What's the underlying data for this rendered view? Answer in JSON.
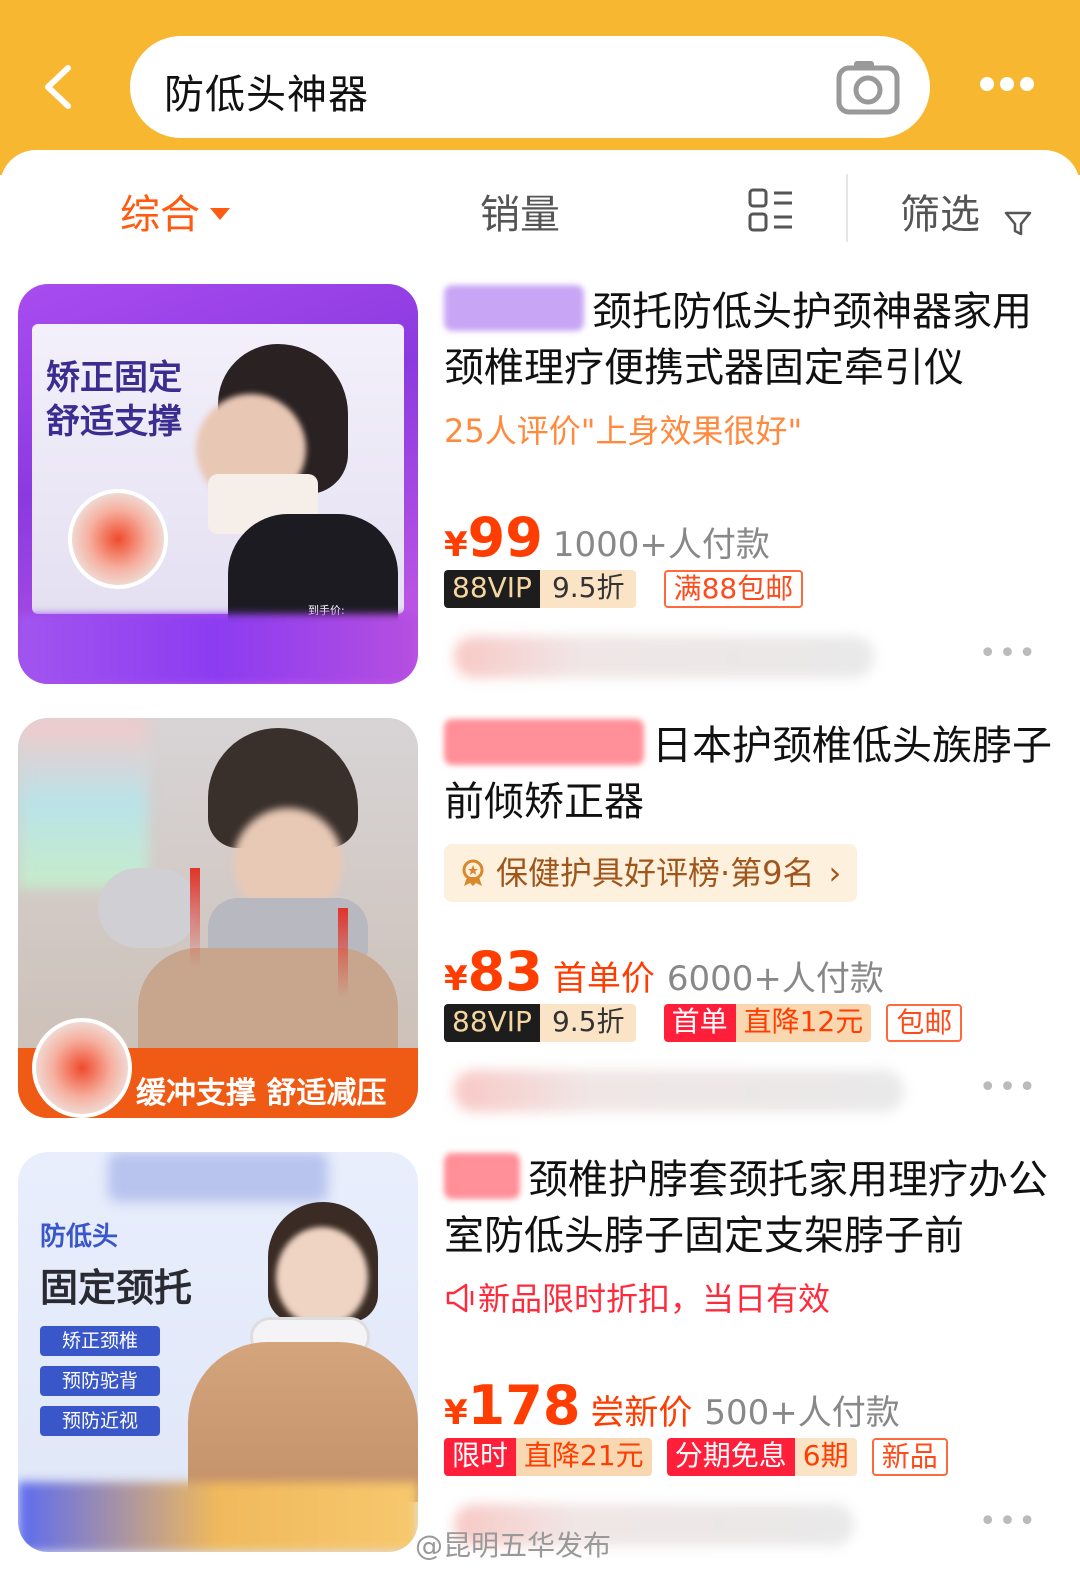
{
  "header": {
    "search_value": "防低头神器",
    "bg_color": "#f7b731"
  },
  "sortbar": {
    "zonghe": "综合",
    "xiaoliang": "销量",
    "filter": "筛选",
    "active_color": "#ff5b10"
  },
  "products": [
    {
      "title": "颈托防低头护颈神器家用颈椎理疗便携式器固定牵引仪",
      "tagline": "25人评价\"上身效果很好\"",
      "yen": "¥",
      "price": "99",
      "sold": "1000+人付款",
      "vip_label": "88VIP",
      "vip_discount": "9.5折",
      "badge_outline": "满88包邮",
      "thumb_text_1": "矫正固定",
      "thumb_text_2": "舒适支撑",
      "thumb_small": "到手价:"
    },
    {
      "title": "日本护颈椎低头族脖子前倾矫正器",
      "rank": "保健护具好评榜·第9名",
      "yen": "¥",
      "price": "83",
      "price_label": "首单价",
      "sold": "6000+人付款",
      "vip_label": "88VIP",
      "vip_discount": "9.5折",
      "badge_red": "首单",
      "badge_red_mid": "直降12元",
      "badge_outline": "包邮",
      "thumb_banner": "缓冲支撑 舒适减压"
    },
    {
      "title": "颈椎护脖套颈托家用理疗办公室防低头脖子固定支架脖子前",
      "tagline": "新品限时折扣，当日有效",
      "yen": "¥",
      "price": "178",
      "price_label": "尝新价",
      "sold": "500+人付款",
      "badge_red": "限时",
      "badge_red_mid": "直降21元",
      "badge_pink": "分期免息",
      "badge_pink_mid": "6期",
      "badge_outline": "新品",
      "thumb_text_1": "防低头",
      "thumb_text_2": "固定颈托",
      "thumb_tags": [
        "矫正颈椎",
        "预防驼背",
        "预防近视"
      ]
    }
  ],
  "watermark": "@昆明五华发布"
}
